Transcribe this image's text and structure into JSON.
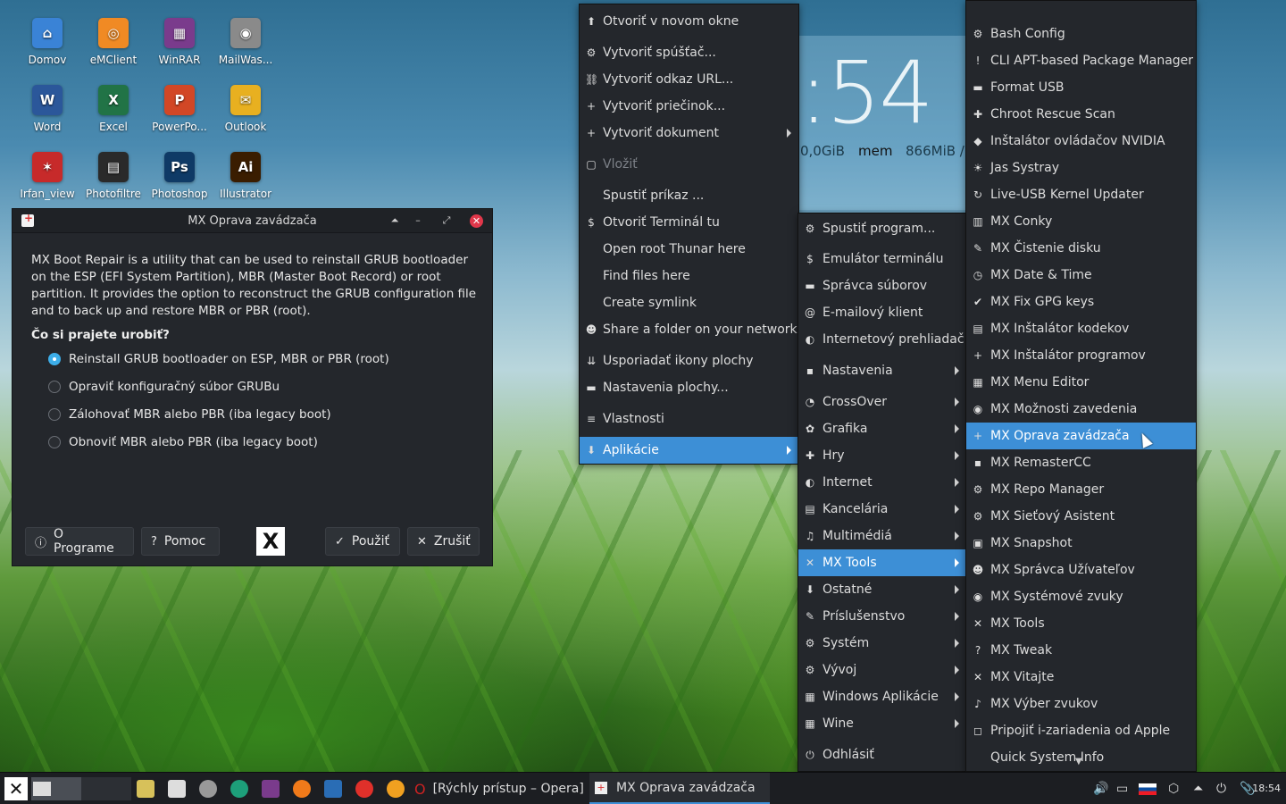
{
  "desktop": {
    "icons": [
      {
        "label": "Domov",
        "icon": "home-folder-icon",
        "color": "#3a83d6"
      },
      {
        "label": "eMClient",
        "icon": "emclient-icon",
        "color": "#f08a24"
      },
      {
        "label": "WinRAR",
        "icon": "winrar-icon",
        "color": "#7a3b8c"
      },
      {
        "label": "MailWas...",
        "icon": "mailwasher-icon",
        "color": "#8a8a8a"
      },
      {
        "label": "Word",
        "icon": "word-icon",
        "color": "#2b579a"
      },
      {
        "label": "Excel",
        "icon": "excel-icon",
        "color": "#217346"
      },
      {
        "label": "PowerPo...",
        "icon": "powerpoint-icon",
        "color": "#d24726"
      },
      {
        "label": "Outlook",
        "icon": "outlook-icon",
        "color": "#e8b020"
      },
      {
        "label": "Irfan_view",
        "icon": "irfanview-icon",
        "color": "#c72a2a"
      },
      {
        "label": "Photofiltre",
        "icon": "photofiltre-icon",
        "color": "#2a2a2a"
      },
      {
        "label": "Photoshop",
        "icon": "photoshop-icon",
        "color": "#0f3a66"
      },
      {
        "label": "Illustrator",
        "icon": "illustrator-icon",
        "color": "#3a1d00"
      }
    ],
    "icon_glyphs": [
      "⌂",
      "◎",
      "▦",
      "◉",
      "W",
      "X",
      "P",
      "✉",
      "✶",
      "▤",
      "Ps",
      "Ai"
    ]
  },
  "conky": {
    "time": ":54",
    "disk": "0,0GiB",
    "mem_label": "mem",
    "mem_value": "866MiB /"
  },
  "dialog": {
    "title": "MX Oprava zavádzača",
    "description": "MX Boot Repair is a utility that can be used to reinstall GRUB bootloader on the ESP (EFI System Partition), MBR (Master Boot Record) or root partition. It provides the option to reconstruct the GRUB configuration file and to back up and restore MBR or PBR (root).",
    "question": "Čo si prajete urobiť?",
    "options": [
      {
        "label": "Reinstall GRUB bootloader on ESP, MBR or PBR (root)",
        "checked": true
      },
      {
        "label": "Opraviť konfiguračný súbor GRUBu",
        "checked": false
      },
      {
        "label": "Zálohovať MBR alebo PBR (iba legacy boot)",
        "checked": false
      },
      {
        "label": "Obnoviť MBR alebo PBR (iba legacy boot)",
        "checked": false
      }
    ],
    "buttons": {
      "about": "O Programe",
      "help": "Pomoc",
      "apply": "Použiť",
      "cancel": "Zrušiť"
    },
    "logo_text": "X"
  },
  "context_menu": {
    "items": [
      {
        "label": "Otvoriť v novom okne",
        "icon": "open-window-icon",
        "glyph": "⬆",
        "submenu": false,
        "disabled": false
      },
      {
        "label": "Vytvoriť spúšťač...",
        "icon": "launcher-icon",
        "glyph": "⚙",
        "submenu": false,
        "disabled": false
      },
      {
        "label": "Vytvoriť odkaz URL...",
        "icon": "link-icon",
        "glyph": "⛓",
        "submenu": false,
        "disabled": false
      },
      {
        "label": "Vytvoriť priečinok...",
        "icon": "new-folder-icon",
        "glyph": "+",
        "submenu": false,
        "disabled": false
      },
      {
        "label": "Vytvoriť dokument",
        "icon": "new-document-icon",
        "glyph": "+",
        "submenu": true,
        "disabled": false
      },
      {
        "label": "Vložiť",
        "icon": "paste-icon",
        "glyph": "▢",
        "submenu": false,
        "disabled": true
      },
      {
        "label": "Spustiť príkaz ...",
        "icon": "",
        "glyph": "",
        "submenu": false,
        "disabled": false
      },
      {
        "label": "Otvoriť Terminál tu",
        "icon": "terminal-icon",
        "glyph": "$",
        "submenu": false,
        "disabled": false
      },
      {
        "label": "Open root Thunar here",
        "icon": "",
        "glyph": "",
        "submenu": false,
        "disabled": false
      },
      {
        "label": "Find files here",
        "icon": "",
        "glyph": "",
        "submenu": false,
        "disabled": false
      },
      {
        "label": "Create symlink",
        "icon": "",
        "glyph": "",
        "submenu": false,
        "disabled": false
      },
      {
        "label": "Share a folder on your network",
        "icon": "share-icon",
        "glyph": "☻",
        "submenu": false,
        "disabled": false
      },
      {
        "label": "Usporiadať ikony plochy",
        "icon": "arrange-icon",
        "glyph": "⇊",
        "submenu": false,
        "disabled": false
      },
      {
        "label": "Nastavenia plochy...",
        "icon": "desktop-settings-icon",
        "glyph": "▬",
        "submenu": false,
        "disabled": false
      },
      {
        "label": "Vlastnosti",
        "icon": "properties-icon",
        "glyph": "≡",
        "submenu": false,
        "disabled": false
      },
      {
        "label": "Aplikácie",
        "icon": "applications-icon",
        "glyph": "⬇",
        "submenu": true,
        "disabled": false,
        "active": true
      }
    ]
  },
  "apps_menu": {
    "items": [
      {
        "label": "Spustiť program...",
        "icon": "run-icon",
        "glyph": "⚙",
        "submenu": false
      },
      {
        "label": "Emulátor terminálu",
        "icon": "terminal-icon",
        "glyph": "$",
        "submenu": false
      },
      {
        "label": "Správca súborov",
        "icon": "file-manager-icon",
        "glyph": "▬",
        "submenu": false
      },
      {
        "label": "E-mailový klient",
        "icon": "email-icon",
        "glyph": "@",
        "submenu": false
      },
      {
        "label": "Internetový prehliadač",
        "icon": "browser-icon",
        "glyph": "◐",
        "submenu": false
      },
      {
        "label": "Nastavenia",
        "icon": "settings-icon",
        "glyph": "▪",
        "submenu": true
      },
      {
        "label": "CrossOver",
        "icon": "crossover-icon",
        "glyph": "◔",
        "submenu": true
      },
      {
        "label": "Grafika",
        "icon": "graphics-icon",
        "glyph": "✿",
        "submenu": true
      },
      {
        "label": "Hry",
        "icon": "games-icon",
        "glyph": "✚",
        "submenu": true
      },
      {
        "label": "Internet",
        "icon": "internet-icon",
        "glyph": "◐",
        "submenu": true
      },
      {
        "label": "Kancelária",
        "icon": "office-icon",
        "glyph": "▤",
        "submenu": true
      },
      {
        "label": "Multimédiá",
        "icon": "multimedia-icon",
        "glyph": "♫",
        "submenu": true
      },
      {
        "label": "MX Tools",
        "icon": "mx-tools-icon",
        "glyph": "✕",
        "submenu": true,
        "active": true
      },
      {
        "label": "Ostatné",
        "icon": "other-icon",
        "glyph": "⬇",
        "submenu": true
      },
      {
        "label": "Príslušenstvo",
        "icon": "accessories-icon",
        "glyph": "✎",
        "submenu": true
      },
      {
        "label": "Systém",
        "icon": "system-icon",
        "glyph": "⚙",
        "submenu": true
      },
      {
        "label": "Vývoj",
        "icon": "development-icon",
        "glyph": "⚙",
        "submenu": true
      },
      {
        "label": "Windows Aplikácie",
        "icon": "windows-apps-icon",
        "glyph": "▦",
        "submenu": true
      },
      {
        "label": "Wine",
        "icon": "wine-icon",
        "glyph": "▦",
        "submenu": true
      },
      {
        "label": "Odhlásiť",
        "icon": "logout-icon",
        "glyph": "⏻",
        "submenu": false
      }
    ]
  },
  "mx_tools_menu": {
    "items": [
      {
        "label": "Bash Config",
        "icon": "bash-config-icon",
        "glyph": "⚙"
      },
      {
        "label": "CLI APT-based Package Manager",
        "icon": "package-manager-icon",
        "glyph": "!"
      },
      {
        "label": "Format USB",
        "icon": "format-usb-icon",
        "glyph": "▬"
      },
      {
        "label": "Chroot Rescue Scan",
        "icon": "rescue-icon",
        "glyph": "✚"
      },
      {
        "label": "Inštalátor ovládačov NVIDIA",
        "icon": "nvidia-icon",
        "glyph": "◆"
      },
      {
        "label": "Jas Systray",
        "icon": "brightness-icon",
        "glyph": "☀"
      },
      {
        "label": "Live-USB Kernel Updater",
        "icon": "kernel-updater-icon",
        "glyph": "↻"
      },
      {
        "label": "MX Conky",
        "icon": "conky-icon",
        "glyph": "▥"
      },
      {
        "label": "MX Čistenie disku",
        "icon": "cleanup-icon",
        "glyph": "✎"
      },
      {
        "label": "MX Date & Time",
        "icon": "clock-icon",
        "glyph": "◷"
      },
      {
        "label": "MX Fix GPG keys",
        "icon": "gpg-key-icon",
        "glyph": "✔"
      },
      {
        "label": "MX Inštalátor kodekov",
        "icon": "codec-icon",
        "glyph": "▤"
      },
      {
        "label": "MX Inštalátor programov",
        "icon": "package-installer-icon",
        "glyph": "+"
      },
      {
        "label": "MX Menu Editor",
        "icon": "menu-editor-icon",
        "glyph": "▦"
      },
      {
        "label": "MX Možnosti zavedenia",
        "icon": "boot-options-icon",
        "glyph": "◉"
      },
      {
        "label": "MX Oprava zavádzača",
        "icon": "boot-repair-icon",
        "glyph": "+",
        "active": true
      },
      {
        "label": "MX RemasterCC",
        "icon": "remaster-icon",
        "glyph": "▪"
      },
      {
        "label": "MX Repo Manager",
        "icon": "repo-manager-icon",
        "glyph": "⚙"
      },
      {
        "label": "MX Sieťový Asistent",
        "icon": "network-icon",
        "glyph": "⚙"
      },
      {
        "label": "MX Snapshot",
        "icon": "snapshot-icon",
        "glyph": "▣"
      },
      {
        "label": "MX Správca Užívateľov",
        "icon": "users-icon",
        "glyph": "☻"
      },
      {
        "label": "MX Systémové zvuky",
        "icon": "sounds-icon",
        "glyph": "◉"
      },
      {
        "label": "MX Tools",
        "icon": "mx-tools-icon",
        "glyph": "✕"
      },
      {
        "label": "MX Tweak",
        "icon": "tweak-icon",
        "glyph": "?"
      },
      {
        "label": "MX Vitajte",
        "icon": "welcome-icon",
        "glyph": "✕"
      },
      {
        "label": "MX Výber zvukov",
        "icon": "sound-select-icon",
        "glyph": "♪"
      },
      {
        "label": "Pripojiť i-zariadenia od Apple",
        "icon": "apple-devices-icon",
        "glyph": "◻"
      },
      {
        "label": "Quick System Info",
        "icon": "system-info-icon",
        "glyph": ""
      }
    ]
  },
  "taskbar": {
    "opera_task": "[Rýchly prístup – Opera]",
    "mx_task": "MX Oprava zavádzača",
    "clock": "18:54"
  },
  "colors": {
    "menu_bg": "#24272c",
    "highlight": "#3d8fd6",
    "dialog_bg": "#24272c",
    "radio_checked": "#3daee9"
  }
}
